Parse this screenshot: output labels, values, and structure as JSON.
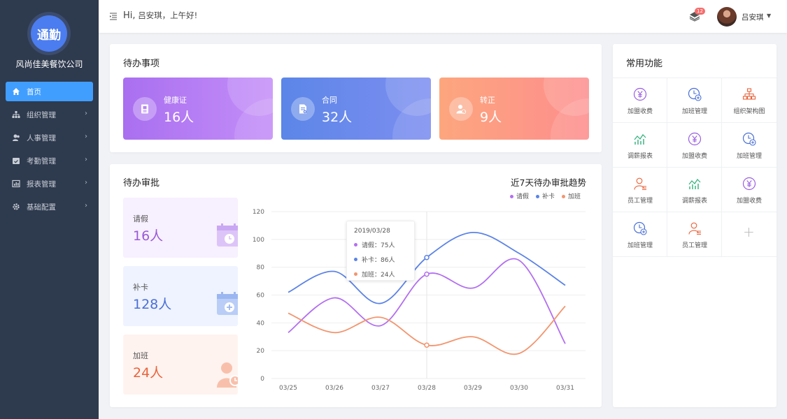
{
  "sidebar": {
    "logo_text": "通勤",
    "company": "风尚佳美餐饮公司",
    "items": [
      {
        "label": "首页",
        "icon": "home-icon",
        "active": true
      },
      {
        "label": "组织管理",
        "icon": "org-tree-icon"
      },
      {
        "label": "人事管理",
        "icon": "users-icon"
      },
      {
        "label": "考勤管理",
        "icon": "calendar-check-icon"
      },
      {
        "label": "报表管理",
        "icon": "report-icon"
      },
      {
        "label": "基础配置",
        "icon": "gear-icon"
      }
    ]
  },
  "header": {
    "hi": "Hi,",
    "greeting": "吕安琪，上午好!",
    "notify_count": "12",
    "user_name": "吕安琪"
  },
  "todo": {
    "title": "待办事项",
    "tiles": [
      {
        "label": "健康证",
        "value": "16人",
        "icon": "certificate-icon"
      },
      {
        "label": "合同",
        "value": "32人",
        "icon": "contract-icon"
      },
      {
        "label": "转正",
        "value": "9人",
        "icon": "user-check-icon"
      }
    ]
  },
  "approval": {
    "title": "待办审批",
    "stats": [
      {
        "label": "请假",
        "value": "16人",
        "color": "#9b59d6"
      },
      {
        "label": "补卡",
        "value": "128人",
        "color": "#4a6fd6"
      },
      {
        "label": "加班",
        "value": "24人",
        "color": "#e8643c"
      }
    ]
  },
  "chart_data": {
    "type": "line",
    "title": "近7天待办审批趋势",
    "categories": [
      "03/25",
      "03/26",
      "03/27",
      "03/28",
      "03/29",
      "03/30",
      "03/31"
    ],
    "ylim": [
      0,
      120
    ],
    "yticks": [
      0,
      20,
      40,
      60,
      80,
      100,
      120
    ],
    "legend_position": "top-right",
    "series": [
      {
        "name": "请假",
        "color": "#b36ff0",
        "values": [
          33,
          58,
          38,
          75,
          65,
          85,
          25
        ]
      },
      {
        "name": "补卡",
        "color": "#5b83e6",
        "values": [
          62,
          77,
          54,
          87,
          105,
          90,
          67
        ]
      },
      {
        "name": "加班",
        "color": "#f2956e",
        "values": [
          47,
          33,
          44,
          24,
          30,
          18,
          52
        ]
      }
    ],
    "tooltip": {
      "date": "2019/03/28",
      "rows": [
        {
          "text": "请假：75人",
          "color": "#b36ff0"
        },
        {
          "text": "补卡：86人",
          "color": "#5b83e6"
        },
        {
          "text": "加班：24人",
          "color": "#f2956e"
        }
      ]
    }
  },
  "common": {
    "title": "常用功能",
    "rows": [
      [
        {
          "label": "加盟收费",
          "icon": "yen-icon"
        },
        {
          "label": "加班管理",
          "icon": "clock-plus-icon"
        },
        {
          "label": "组织架构图",
          "icon": "org-chart-icon"
        }
      ],
      [
        {
          "label": "调薪报表",
          "icon": "salary-chart-icon"
        },
        {
          "label": "加盟收费",
          "icon": "yen-icon"
        },
        {
          "label": "加班管理",
          "icon": "clock-plus-icon"
        }
      ],
      [
        {
          "label": "员工管理",
          "icon": "employee-icon"
        },
        {
          "label": "调薪报表",
          "icon": "salary-chart-icon"
        },
        {
          "label": "加盟收费",
          "icon": "yen-icon"
        }
      ],
      [
        {
          "label": "加班管理",
          "icon": "clock-plus-icon"
        },
        {
          "label": "员工管理",
          "icon": "employee-icon"
        },
        {
          "label": "",
          "icon": "plus-icon"
        }
      ]
    ]
  }
}
